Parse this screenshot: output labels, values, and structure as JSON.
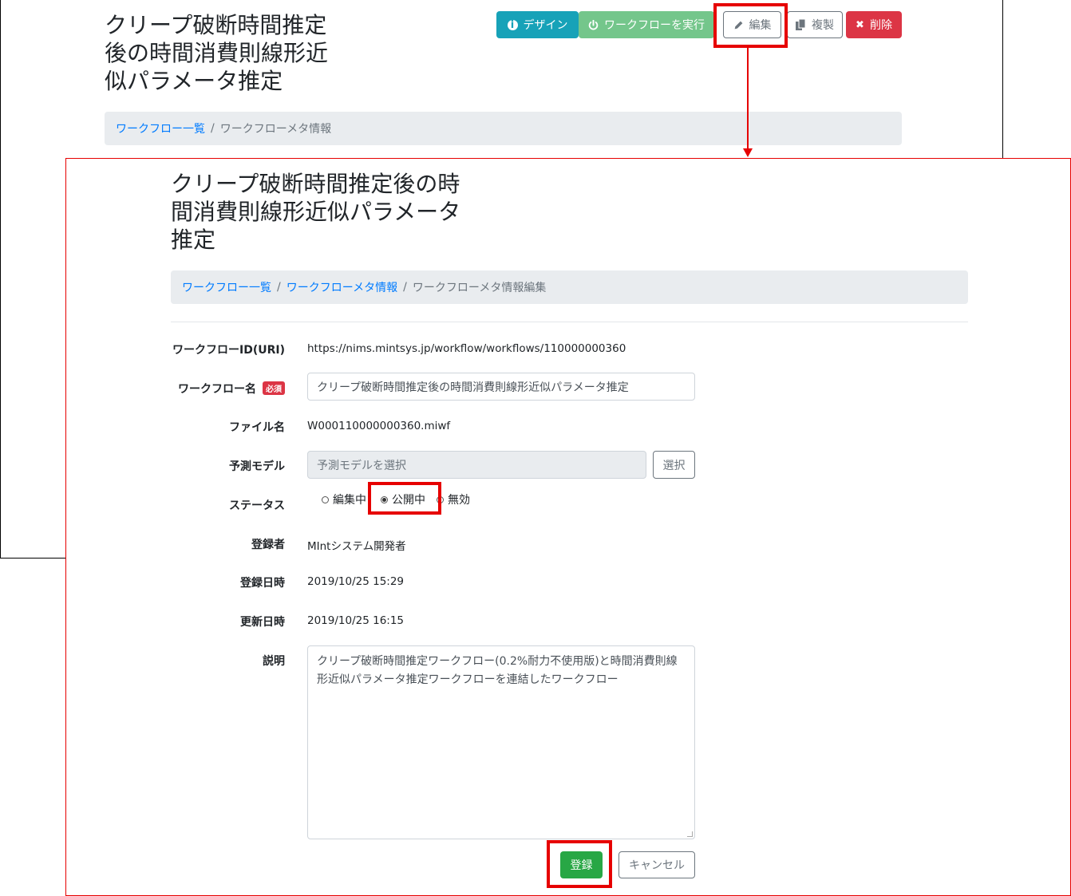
{
  "back_page": {
    "title": "クリープ破断時間推定後の時間消費則線形近似パラメータ推定",
    "toolbar": {
      "design_label": "デザイン",
      "run_label": "ワークフローを実行",
      "edit_label": "編集",
      "copy_label": "複製",
      "delete_label": "削除"
    },
    "breadcrumb": {
      "list_label": "ワークフロー一覧",
      "separator": "/",
      "current_label": "ワークフローメタ情報"
    }
  },
  "edit_page": {
    "title": "クリープ破断時間推定後の時間消費則線形近似パラメータ推定",
    "breadcrumb": {
      "list_label": "ワークフロー一覧",
      "meta_label": "ワークフローメタ情報",
      "separator": "/",
      "current_label": "ワークフローメタ情報編集"
    },
    "form": {
      "id_label": "ワークフローID(URI)",
      "id_value": "https://nims.mintsys.jp/workflow/workflows/110000000360",
      "name_label": "ワークフロー名",
      "required_badge": "必須",
      "name_value": "クリープ破断時間推定後の時間消費則線形近似パラメータ推定",
      "file_label": "ファイル名",
      "file_value": "W000110000000360.miwf",
      "model_label": "予測モデル",
      "model_placeholder": "予測モデルを選択",
      "select_button": "選択",
      "status_label": "ステータス",
      "status_options": [
        "編集中",
        "公開中",
        "無効"
      ],
      "status_selected": "公開中",
      "registrant_label": "登録者",
      "registrant_value": "MIntシステム開発者",
      "created_label": "登録日時",
      "created_value": "2019/10/25 15:29",
      "updated_label": "更新日時",
      "updated_value": "2019/10/25 16:15",
      "desc_label": "説明",
      "desc_value": "クリープ破断時間推定ワークフロー(0.2%耐力不使用版)と時間消費則線形近似パラメータ推定ワークフローを連結したワークフロー",
      "register_button": "登録",
      "cancel_button": "キャンセル"
    }
  },
  "colors": {
    "highlight": "#e60000",
    "info": "#17a2b8",
    "success": "#28a745",
    "danger": "#dc3545",
    "link": "#007bff"
  }
}
